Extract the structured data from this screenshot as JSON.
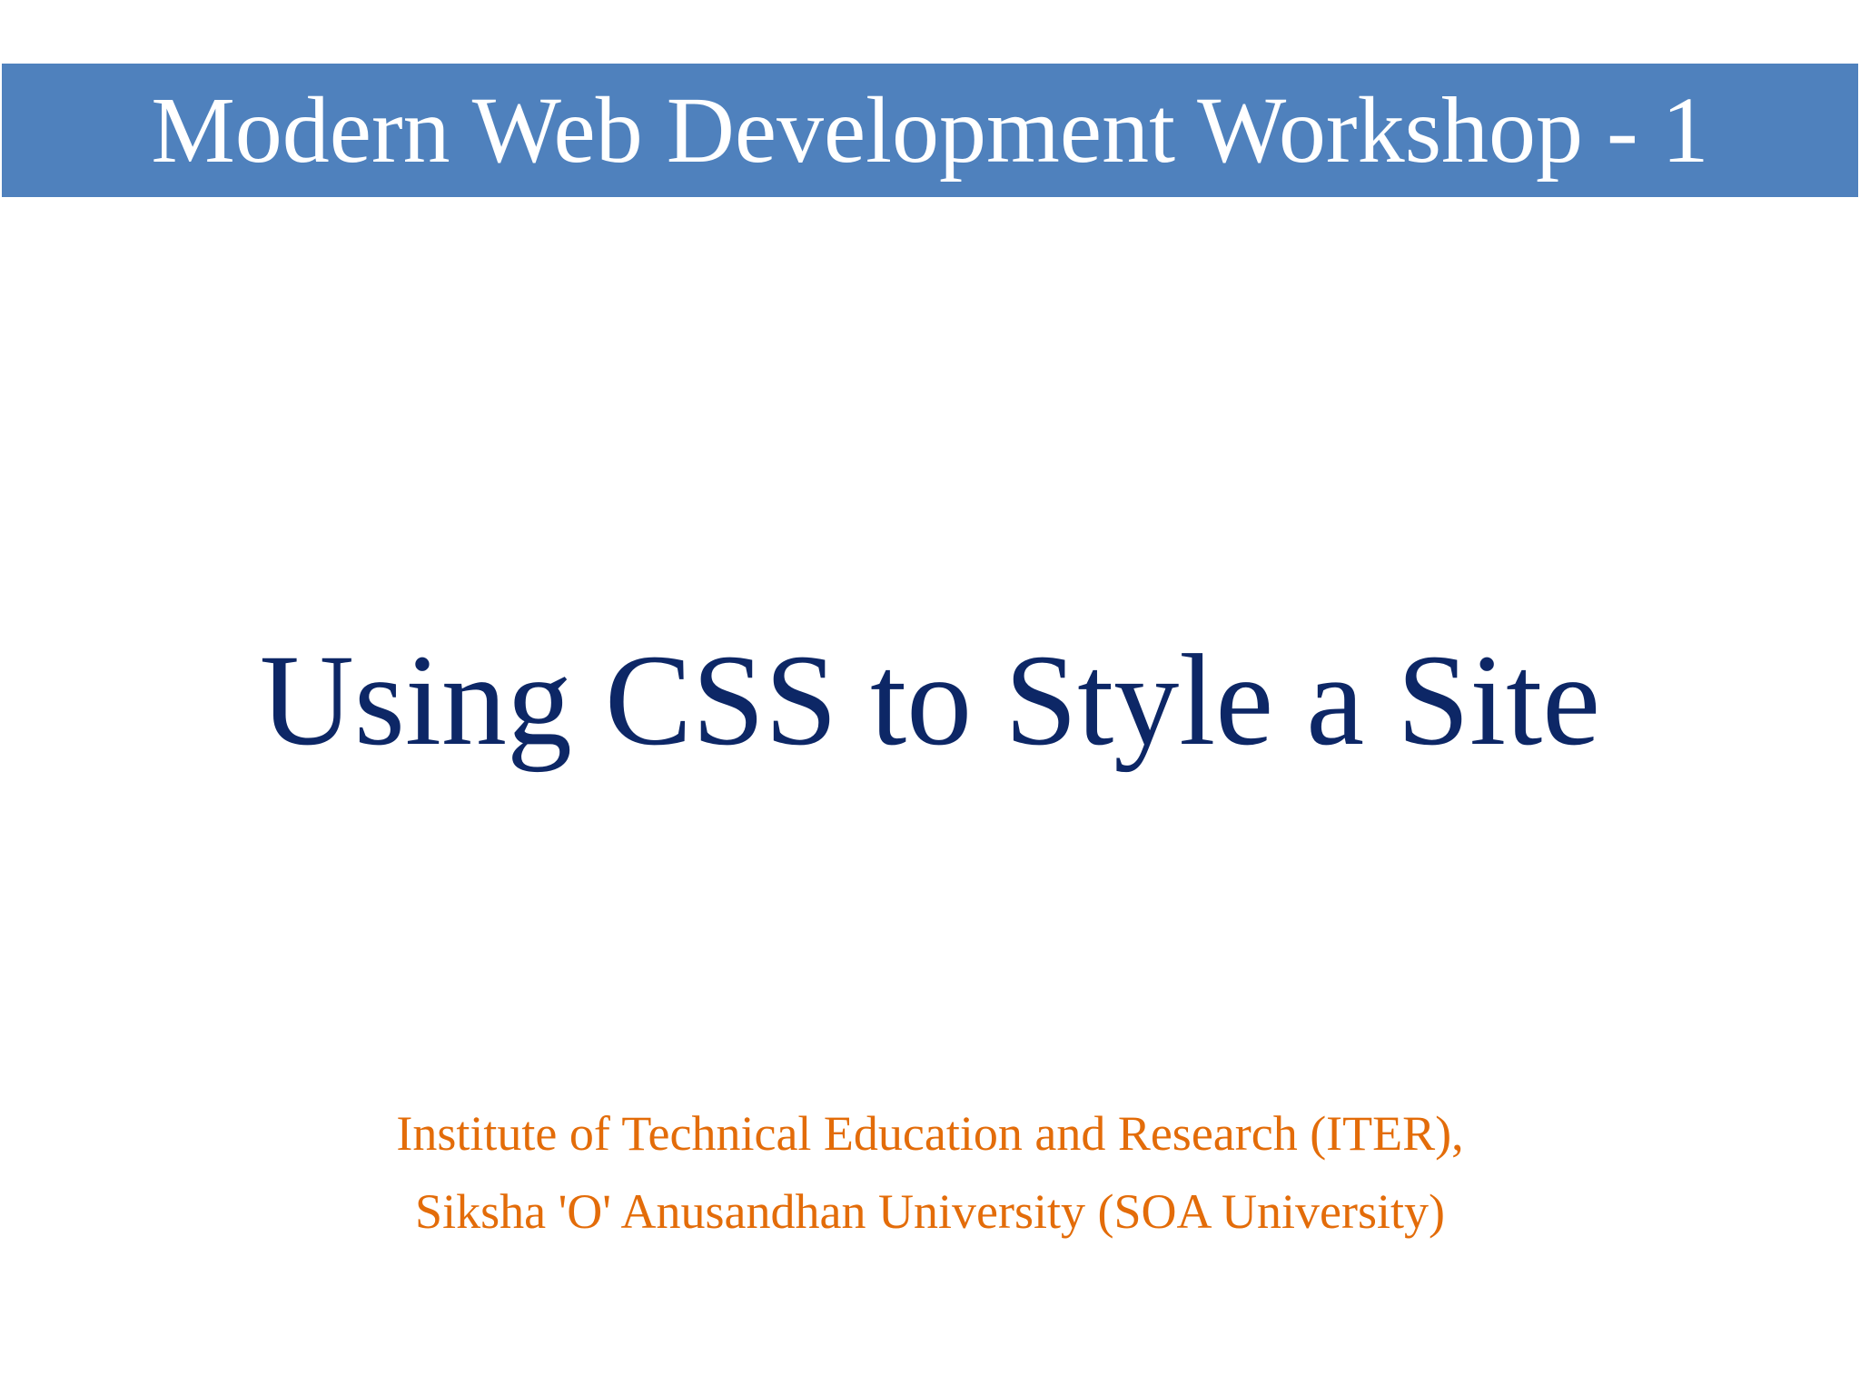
{
  "header": {
    "title": "Modern Web Development Workshop - 1"
  },
  "main": {
    "title": "Using CSS to Style a Site"
  },
  "footer": {
    "lines": [
      "Institute of Technical Education and Research (ITER),",
      "Siksha 'O' Anusandhan University (SOA University)"
    ]
  },
  "colors": {
    "header_band": "#4F81BD",
    "header_text": "#FFFFFF",
    "main_title": "#0D2766",
    "footer_text": "#E36C09"
  }
}
